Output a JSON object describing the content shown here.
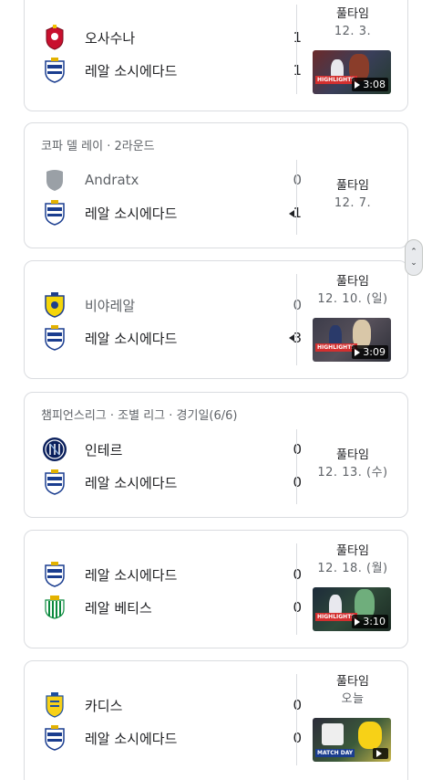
{
  "matches": [
    {
      "header": "",
      "status": "풀타임",
      "date": "12. 3.",
      "home": {
        "name": "오사수나",
        "score": "1"
      },
      "away": {
        "name": "레알 소시에다드",
        "score": "1"
      },
      "video": {
        "duration": "3:08",
        "badge": "HIGHLIGHTS"
      }
    },
    {
      "header": "코파 델 레이 · 2라운드",
      "status": "풀타임",
      "date": "12. 7.",
      "home": {
        "name": "Andratx",
        "score": "0"
      },
      "away": {
        "name": "레알 소시에다드",
        "score": "1"
      }
    },
    {
      "header": "",
      "status": "풀타임",
      "date": "12. 10. (일)",
      "home": {
        "name": "비야레알",
        "score": "0"
      },
      "away": {
        "name": "레알 소시에다드",
        "score": "3"
      },
      "video": {
        "duration": "3:09",
        "badge": "HIGHLIGHTS"
      }
    },
    {
      "header": "챔피언스리그 · 조별 리그 · 경기일(6/6)",
      "status": "풀타임",
      "date": "12. 13. (수)",
      "home": {
        "name": "인테르",
        "score": "0"
      },
      "away": {
        "name": "레알 소시에다드",
        "score": "0"
      }
    },
    {
      "header": "",
      "status": "풀타임",
      "date": "12. 18. (월)",
      "home": {
        "name": "레알 소시에다드",
        "score": "0"
      },
      "away": {
        "name": "레알 베티스",
        "score": "0"
      },
      "video": {
        "duration": "3:10",
        "badge": "HIGHLIGHTS"
      }
    },
    {
      "header": "",
      "status": "풀타임",
      "date": "오늘",
      "home": {
        "name": "카디스",
        "score": "0"
      },
      "away": {
        "name": "레알 소시에다드",
        "score": "0"
      },
      "video": {
        "duration": "",
        "badge": "MATCH DAY"
      }
    }
  ],
  "icons": {
    "osasuna": "osasuna-crest-icon",
    "real_sociedad": "real-sociedad-crest-icon",
    "andratx": "generic-shield-icon",
    "villarreal": "villarreal-crest-icon",
    "inter": "inter-crest-icon",
    "betis": "real-betis-crest-icon",
    "cadiz": "cadiz-crest-icon"
  },
  "colors": {
    "real_sociedad_blue": "#1a3d8f",
    "osasuna_red": "#c8102e",
    "villarreal_yellow": "#f5d60a",
    "inter_blue": "#0a1f5c",
    "betis_green": "#0b8a3e",
    "cadiz_yellow": "#f7d117",
    "highlight_red": "#d32f2f"
  }
}
